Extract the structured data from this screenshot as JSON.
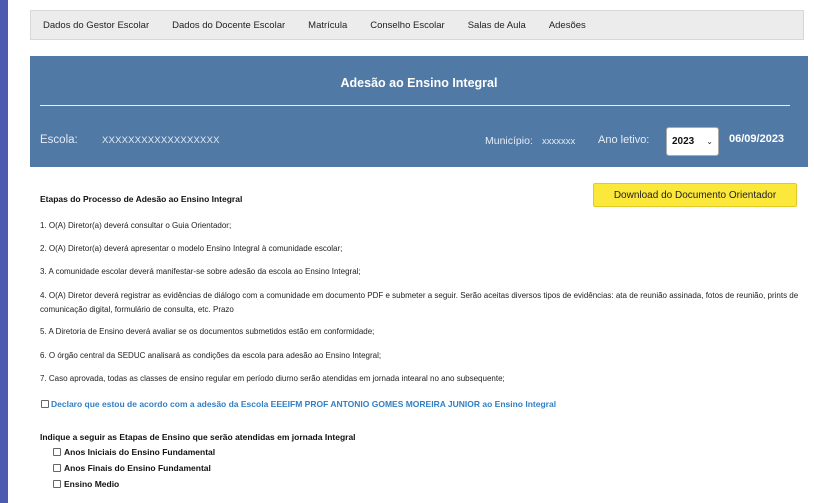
{
  "nav": {
    "items": [
      "Dados do Gestor Escolar",
      "Dados do Docente Escolar",
      "Matrícula",
      "Conselho Escolar",
      "Salas de Aula",
      "Adesões"
    ]
  },
  "header": {
    "title": "Adesão ao Ensino Integral",
    "school_label": "Escola:",
    "school_value": "XXXXXXXXXXXXXXXXXX",
    "municipality_label": "Município:",
    "municipality_value": "xxxxxxx",
    "year_label": "Ano letivo:",
    "year_value": "2023",
    "date": "06/09/2023"
  },
  "colors": {
    "header_bg": "#5079a6",
    "download_button": "#fce83a",
    "agree_text": "#2f7fc7",
    "left_bar": "#4a5bb0"
  },
  "process": {
    "title": "Etapas do Processo de Adesão ao Ensino Integral",
    "download_label": "Download do Documento Orientador",
    "steps": [
      "1. O(A) Diretor(a) deverá consultar o Guia Orientador;",
      "2. O(A) Diretor(a) deverá apresentar o modelo Ensino Integral à comunidade escolar;",
      "3. A comunidade escolar deverá manifestar-se sobre adesão da escola ao Ensino Integral;",
      "4. O(A) Diretor deverá registrar as evidências de diálogo com a comunidade em documento PDF e submeter a seguir. Serão aceitas diversos tipos de evidências: ata de reunião assinada, fotos de reunião, prints de comunicação digital, formulário de consulta, etc. Prazo",
      "5. A Diretoria de Ensino deverá avaliar se os documentos submetidos estão em conformidade;",
      "6. O órgão central da SEDUC analisará as condições da escola para adesão ao Ensino Integral;",
      "7. Caso aprovada, todas as classes de ensino regular em período diurno serão atendidas em jornada intearal no ano subsequente;"
    ],
    "agree_label": "Declaro que estou de acordo com a adesão da Escola EEEIFM PROF ANTONIO GOMES MOREIRA JUNIOR ao Ensino Integral",
    "agree_checked": false
  },
  "stages": {
    "title": "Indique a seguir as Etapas de Ensino que serão atendidas em jornada Integral",
    "options": [
      {
        "label": "Anos Iniciais do Ensino Fundamental",
        "checked": false
      },
      {
        "label": "Anos Finais do Ensino Fundamental",
        "checked": false
      },
      {
        "label": "Ensino Medio",
        "checked": false
      }
    ]
  }
}
